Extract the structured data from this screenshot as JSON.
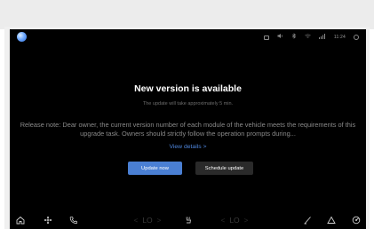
{
  "status_bar": {
    "time": "11:24",
    "icons": [
      "screen-icon",
      "volume-icon",
      "bluetooth-icon",
      "wifi-icon",
      "signal-icon",
      "settings-icon"
    ]
  },
  "dialog": {
    "title": "New version is available",
    "subtitle": "The update will take approximately 5 min.",
    "release_note": "Release note: Dear owner, the current version number of each module of the vehicle meets the requirements of this upgrade task. Owners should strictly follow the operation prompts during...",
    "view_details": "View details >",
    "update_now": "Update now",
    "schedule_update": "Schedule update"
  },
  "dock": {
    "left_temp": "LO",
    "right_temp": "LO",
    "left_arrow": "<",
    "right_arrow": ">"
  },
  "colors": {
    "accent": "#4a7fd3",
    "link": "#4f86dd",
    "screen_bg": "#000000"
  }
}
